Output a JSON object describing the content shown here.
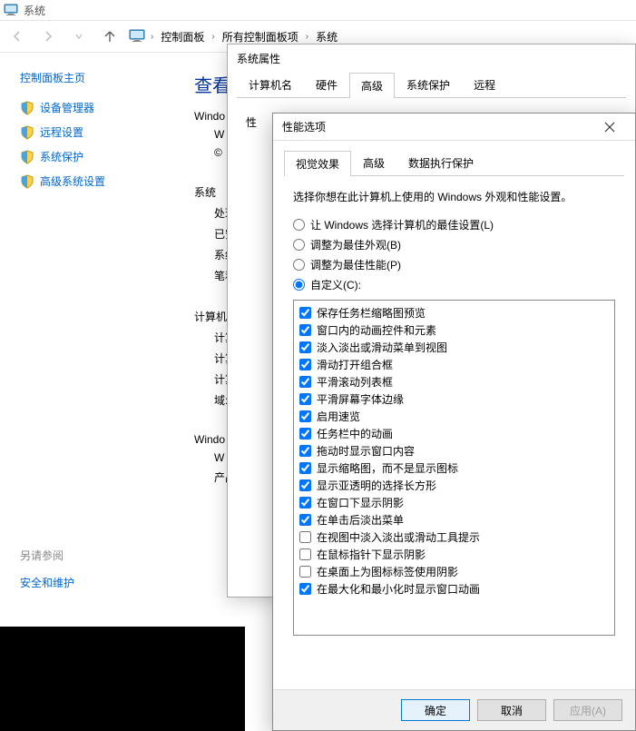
{
  "titlebar": {
    "title": "系统"
  },
  "breadcrumb": {
    "items": [
      "控制面板",
      "所有控制面板项",
      "系统"
    ]
  },
  "leftpane": {
    "home": "控制面板主页",
    "links": [
      {
        "label": "设备管理器",
        "shield": true
      },
      {
        "label": "远程设置",
        "shield": true
      },
      {
        "label": "系统保护",
        "shield": true
      },
      {
        "label": "高级系统设置",
        "shield": true
      }
    ]
  },
  "seealso": {
    "header": "另请参阅",
    "link": "安全和维护"
  },
  "main": {
    "heading": "查看",
    "rows": [
      "Windo",
      "W",
      "©",
      "系统",
      "处理",
      "已安",
      "系统",
      "笔和",
      "计算机",
      "计算",
      "计算",
      "计算",
      "域:",
      "Windo",
      "W",
      "产品"
    ]
  },
  "sysprops": {
    "title": "系统属性",
    "tabs": [
      "计算机名",
      "硬件",
      "高级",
      "系统保护",
      "远程"
    ],
    "active_tab": 2,
    "visible_label": "性"
  },
  "perf": {
    "title": "性能选项",
    "tabs": [
      "视觉效果",
      "高级",
      "数据执行保护"
    ],
    "active_tab": 0,
    "instruction": "选择你想在此计算机上使用的 Windows 外观和性能设置。",
    "radios": [
      {
        "label": "让 Windows 选择计算机的最佳设置(L)",
        "checked": false
      },
      {
        "label": "调整为最佳外观(B)",
        "checked": false
      },
      {
        "label": "调整为最佳性能(P)",
        "checked": false
      },
      {
        "label": "自定义(C):",
        "checked": true
      }
    ],
    "checks": [
      {
        "label": "保存任务栏缩略图预览",
        "checked": true
      },
      {
        "label": "窗口内的动画控件和元素",
        "checked": true
      },
      {
        "label": "淡入淡出或滑动菜单到视图",
        "checked": true
      },
      {
        "label": "滑动打开组合框",
        "checked": true
      },
      {
        "label": "平滑滚动列表框",
        "checked": true
      },
      {
        "label": "平滑屏幕字体边缘",
        "checked": true
      },
      {
        "label": "启用速览",
        "checked": true
      },
      {
        "label": "任务栏中的动画",
        "checked": true
      },
      {
        "label": "拖动时显示窗口内容",
        "checked": true
      },
      {
        "label": "显示缩略图，而不是显示图标",
        "checked": true
      },
      {
        "label": "显示亚透明的选择长方形",
        "checked": true
      },
      {
        "label": "在窗口下显示阴影",
        "checked": true
      },
      {
        "label": "在单击后淡出菜单",
        "checked": true
      },
      {
        "label": "在视图中淡入淡出或滑动工具提示",
        "checked": false
      },
      {
        "label": "在鼠标指针下显示阴影",
        "checked": false
      },
      {
        "label": "在桌面上为图标标签使用阴影",
        "checked": false
      },
      {
        "label": "在最大化和最小化时显示窗口动画",
        "checked": true
      }
    ],
    "buttons": {
      "ok": "确定",
      "cancel": "取消",
      "apply": "应用(A)"
    }
  }
}
